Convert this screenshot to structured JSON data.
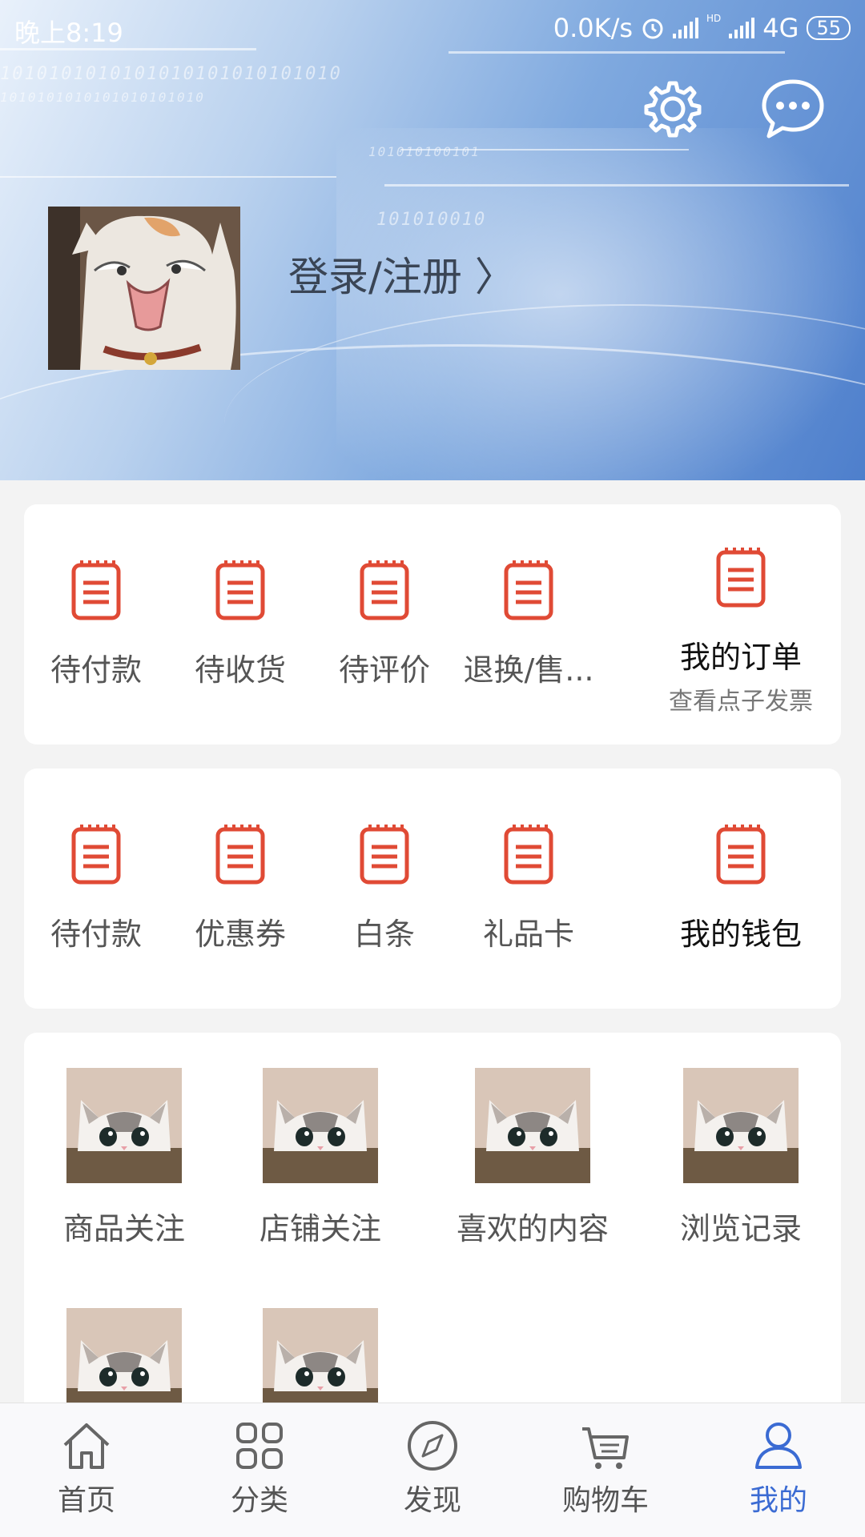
{
  "status": {
    "time": "晚上8:19",
    "speed": "0.0K/s",
    "network": "4G",
    "battery": "55",
    "hd": "HD"
  },
  "header": {
    "bits": [
      "1010101010101010101010101010",
      "1010101010101010101010",
      "101010100101",
      "101010010"
    ],
    "login": "登录/注册 〉"
  },
  "orders": {
    "items": [
      {
        "label": "待付款",
        "icon": "clipboard-icon"
      },
      {
        "label": "待收货",
        "icon": "clipboard-icon"
      },
      {
        "label": "待评价",
        "icon": "clipboard-icon"
      },
      {
        "label": "退换/售...",
        "icon": "clipboard-icon"
      }
    ],
    "main": {
      "label": "我的订单",
      "sub": "查看点子发票",
      "icon": "clipboard-icon"
    }
  },
  "wallet": {
    "items": [
      {
        "label": "待付款",
        "icon": "clipboard-icon"
      },
      {
        "label": "优惠券",
        "icon": "clipboard-icon"
      },
      {
        "label": "白条",
        "icon": "clipboard-icon"
      },
      {
        "label": "礼品卡",
        "icon": "clipboard-icon"
      }
    ],
    "main": {
      "label": "我的钱包",
      "icon": "clipboard-icon"
    }
  },
  "follows": {
    "items": [
      {
        "label": "商品关注"
      },
      {
        "label": "店铺关注"
      },
      {
        "label": "喜欢的内容"
      },
      {
        "label": "浏览记录"
      },
      {
        "label": ""
      },
      {
        "label": ""
      }
    ]
  },
  "tabs": [
    {
      "label": "首页",
      "icon": "home-icon"
    },
    {
      "label": "分类",
      "icon": "grid-icon"
    },
    {
      "label": "发现",
      "icon": "compass-icon"
    },
    {
      "label": "购物车",
      "icon": "cart-icon"
    },
    {
      "label": "我的",
      "icon": "person-icon",
      "active": true
    }
  ],
  "colors": {
    "accent": "#e04a35",
    "tab_active": "#3b6bd3"
  }
}
